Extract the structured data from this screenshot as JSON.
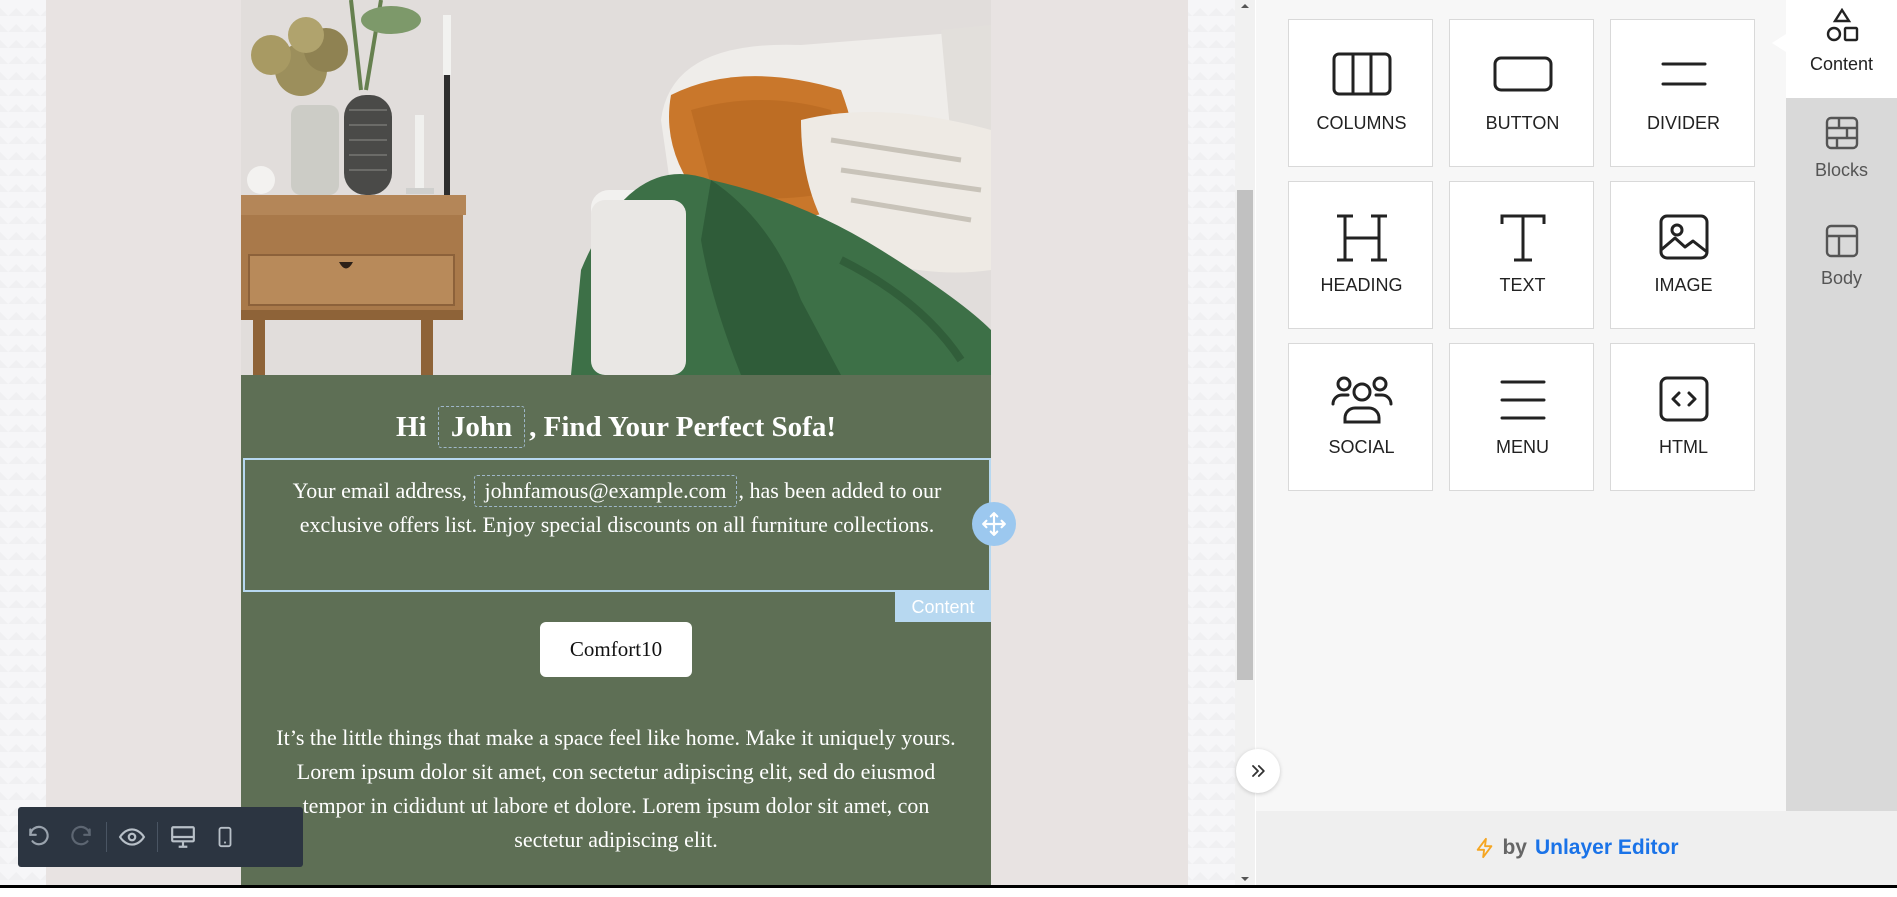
{
  "email": {
    "headline_prefix": "Hi",
    "headline_name": "John",
    "headline_suffix": ", Find Your Perfect Sofa!",
    "content_prefix": "Your email address,",
    "content_email": "johnfamous@example.com",
    "content_suffix": ", has been added to our exclusive offers list. Enjoy special discounts on all furniture collections.",
    "content_tab_label": "Content",
    "button_label": "Comfort10",
    "body_text": "It’s the little things that make a space feel like home. Make it uniquely yours. Lorem ipsum dolor sit amet, con sectetur adipiscing elit, sed do eiusmod tempor in cididunt ut labore et dolore. Lorem ipsum dolor sit amet, con sectetur adipiscing elit."
  },
  "tools": [
    {
      "label": "COLUMNS",
      "icon": "columns-icon"
    },
    {
      "label": "BUTTON",
      "icon": "button-icon"
    },
    {
      "label": "DIVIDER",
      "icon": "divider-icon"
    },
    {
      "label": "HEADING",
      "icon": "heading-icon"
    },
    {
      "label": "TEXT",
      "icon": "text-icon"
    },
    {
      "label": "IMAGE",
      "icon": "image-icon"
    },
    {
      "label": "SOCIAL",
      "icon": "social-icon"
    },
    {
      "label": "MENU",
      "icon": "menu-icon"
    },
    {
      "label": "HTML",
      "icon": "html-icon"
    }
  ],
  "tabs": [
    {
      "label": "Content",
      "icon": "shapes-icon"
    },
    {
      "label": "Blocks",
      "icon": "blocks-icon"
    },
    {
      "label": "Body",
      "icon": "layout-icon"
    }
  ],
  "footer": {
    "by": "by",
    "brand": "Unlayer Editor"
  },
  "toolbar": [
    "undo-icon",
    "redo-icon",
    "preview-icon",
    "desktop-icon",
    "mobile-icon"
  ],
  "colors": {
    "email_background": "#5e6f55",
    "selection": "#b7d8f0",
    "brand_link": "#1a73e8",
    "toolbar": "#2c3541"
  }
}
